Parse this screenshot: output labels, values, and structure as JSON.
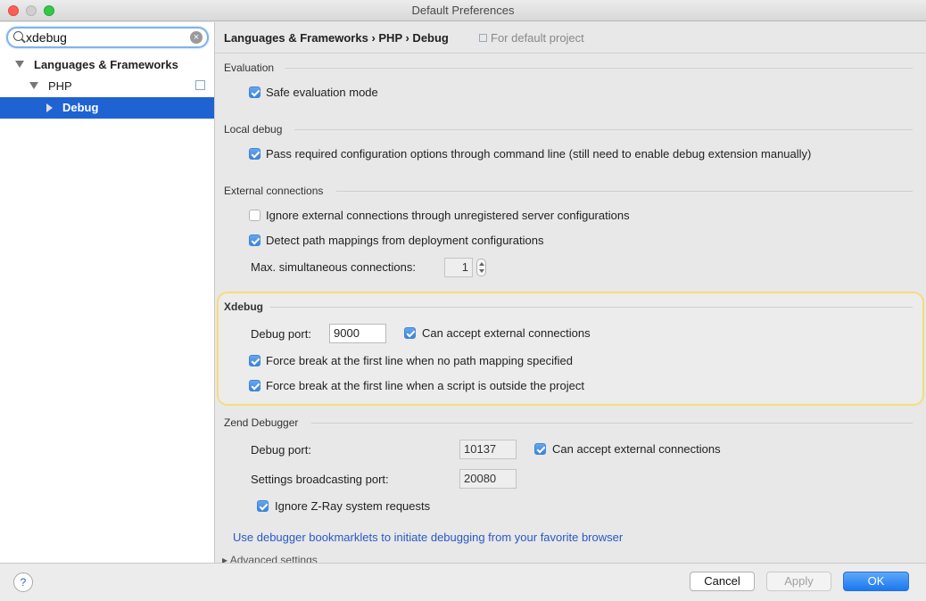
{
  "window": {
    "title": "Default Preferences"
  },
  "sidebar": {
    "search": {
      "value": "xdebug",
      "placeholder": ""
    },
    "tree": [
      {
        "label": "Languages & Frameworks",
        "expanded": true
      },
      {
        "label": "PHP",
        "expanded": true
      },
      {
        "label": "Debug",
        "selected": true
      }
    ]
  },
  "header": {
    "breadcrumb": "Languages & Frameworks › PHP › Debug",
    "note": "For default project"
  },
  "evaluation": {
    "title": "Evaluation",
    "safe_mode": {
      "label": "Safe evaluation mode",
      "checked": true
    }
  },
  "local_debug": {
    "title": "Local debug",
    "pass_options": {
      "label": "Pass required configuration options through command line (still need to enable debug extension manually)",
      "checked": true
    }
  },
  "external": {
    "title": "External connections",
    "ignore_unregistered": {
      "label": "Ignore external connections through unregistered server configurations",
      "checked": false
    },
    "detect_mappings": {
      "label": "Detect path mappings from deployment configurations",
      "checked": true
    },
    "max_connections_label": "Max. simultaneous connections:",
    "max_connections_value": "1"
  },
  "xdebug": {
    "title": "Xdebug",
    "debug_port_label": "Debug port:",
    "debug_port_value": "9000",
    "accept_external": {
      "label": "Can accept external connections",
      "checked": true
    },
    "force_break_no_mapping": {
      "label": "Force break at the first line when no path mapping specified",
      "checked": true
    },
    "force_break_outside": {
      "label": "Force break at the first line when a script is outside the project",
      "checked": true
    }
  },
  "zend": {
    "title": "Zend Debugger",
    "debug_port_label": "Debug port:",
    "debug_port_value": "10137",
    "accept_external": {
      "label": "Can accept external connections",
      "checked": true
    },
    "broadcast_label": "Settings broadcasting port:",
    "broadcast_value": "20080",
    "ignore_zray": {
      "label": "Ignore Z-Ray system requests",
      "checked": true
    }
  },
  "bookmarklets_link": "Use debugger bookmarklets to initiate debugging from your favorite browser",
  "advanced_label": "Advanced settings",
  "buttons": {
    "help": "?",
    "cancel": "Cancel",
    "apply": "Apply",
    "ok": "OK"
  },
  "colors": {
    "selection": "#1f62d2",
    "accent": "#3b83dc",
    "highlight_border": "#f5dd7a",
    "link": "#2a57c6"
  }
}
